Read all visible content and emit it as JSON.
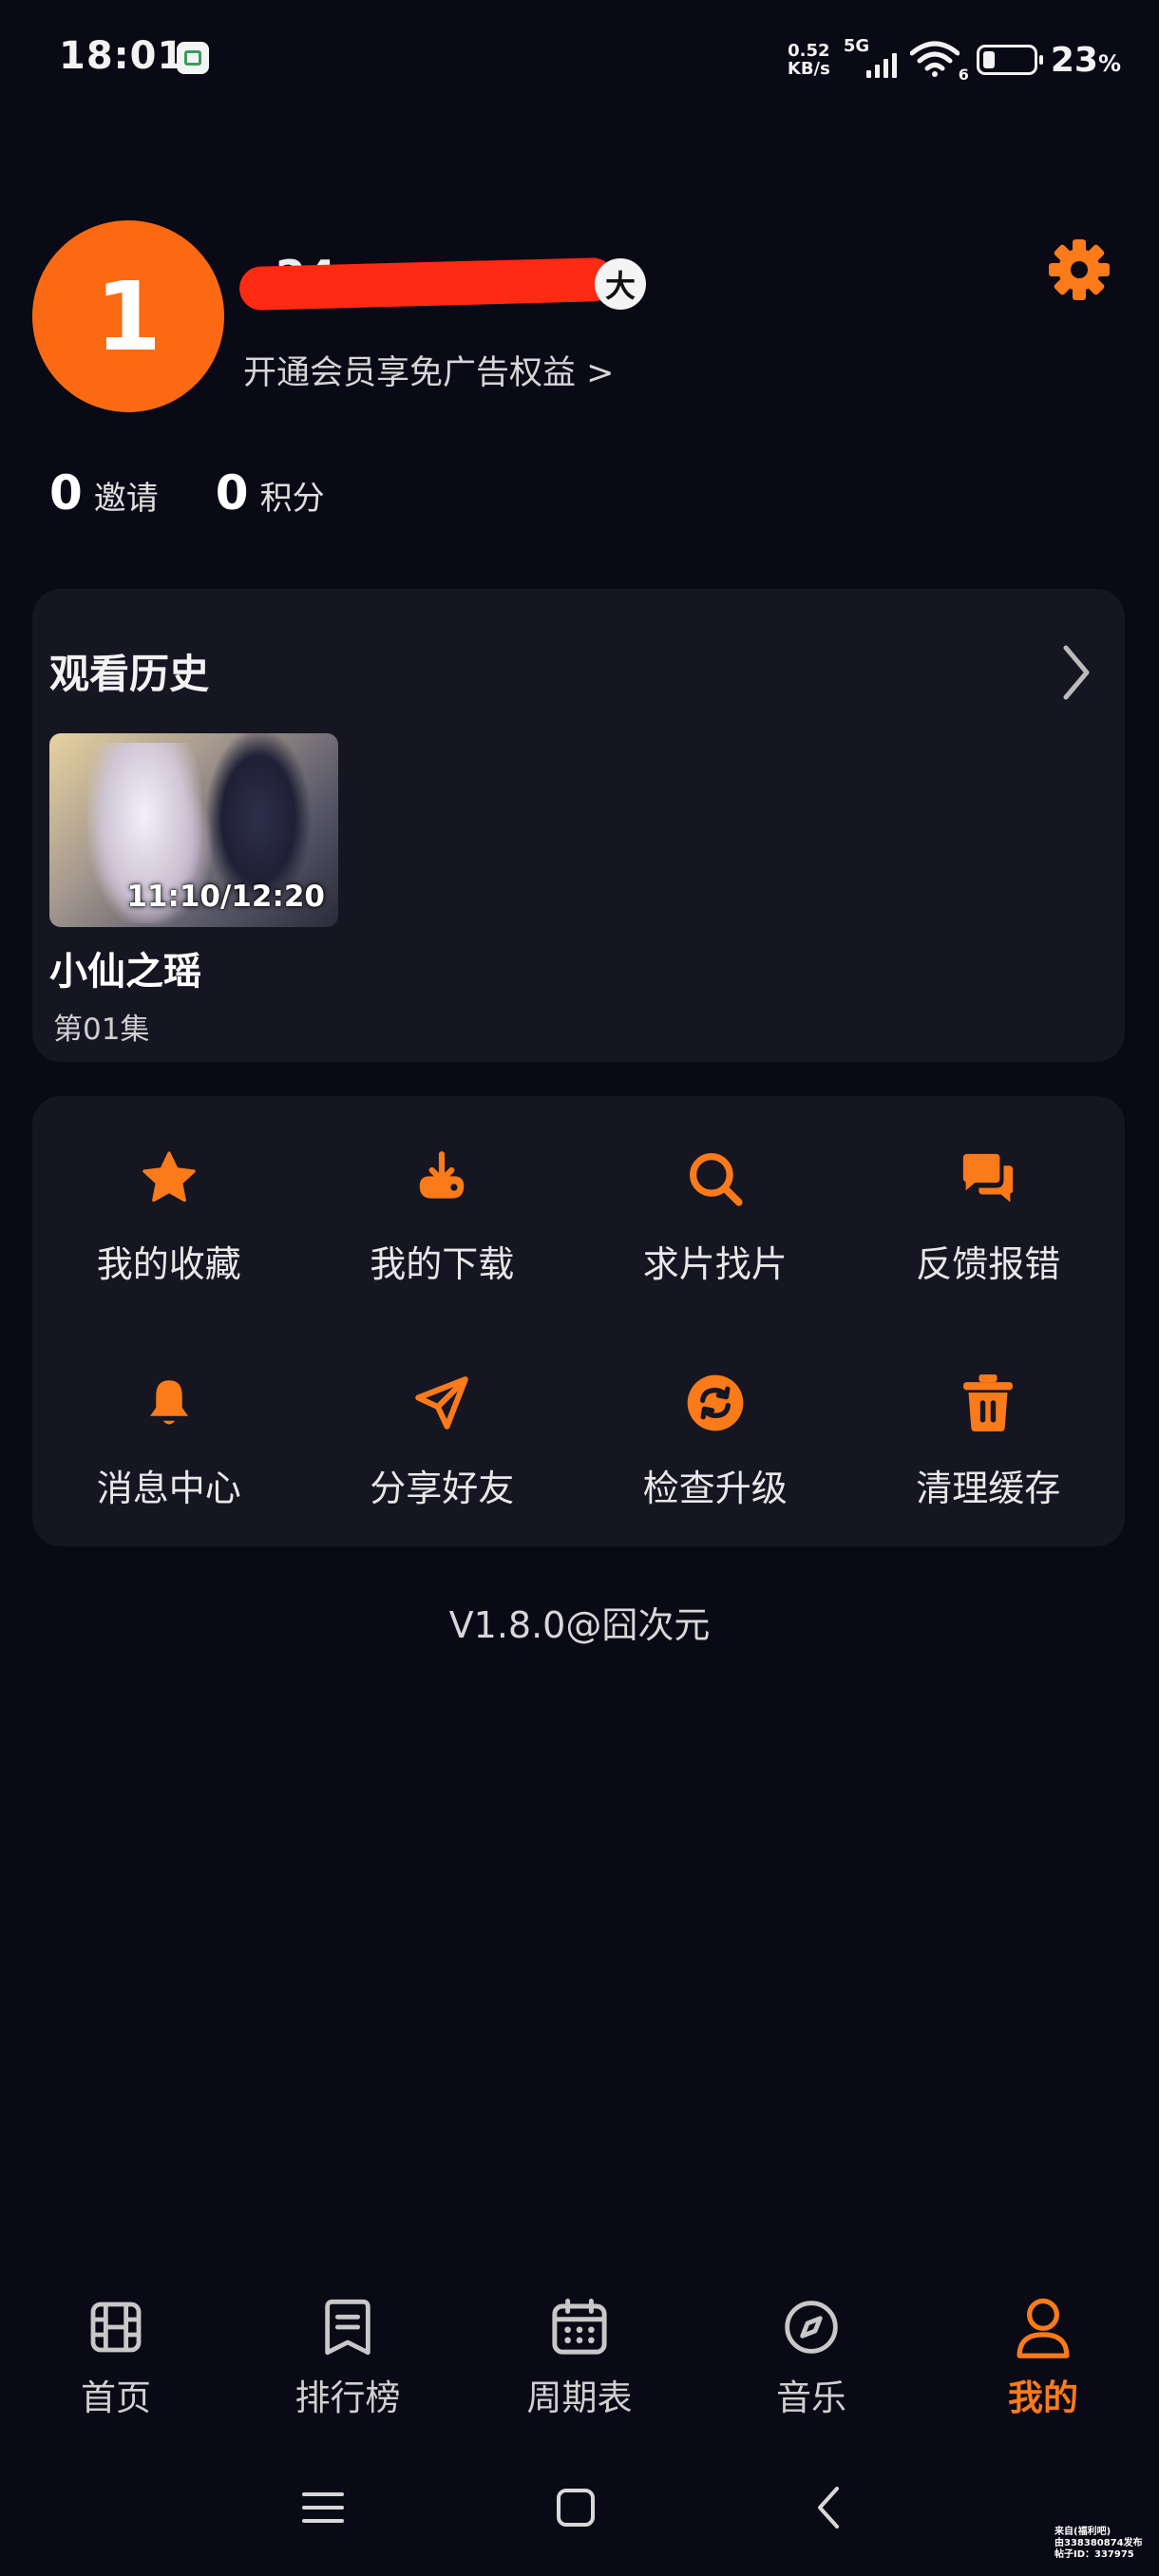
{
  "status_bar": {
    "time": "18:01",
    "net_speed_value": "0.52",
    "net_speed_unit": "KB/s",
    "network_type": "5G",
    "wifi_label": "6",
    "battery_percent": "23",
    "battery_percent_sign": "%",
    "battery_level": 0.23
  },
  "profile": {
    "avatar_text": "1",
    "username_visible": "24",
    "level_badge": "大",
    "vip_prompt": "开通会员享免广告权益 >"
  },
  "stats": [
    {
      "value": "0",
      "label": "邀请"
    },
    {
      "value": "0",
      "label": "积分"
    }
  ],
  "history": {
    "title": "观看历史",
    "items": [
      {
        "title": "小仙之瑶",
        "episode": "第01集",
        "progress_time": "11:10/12:20"
      }
    ]
  },
  "menu": [
    {
      "label": "我的收藏",
      "icon": "star-icon"
    },
    {
      "label": "我的下载",
      "icon": "download-icon"
    },
    {
      "label": "求片找片",
      "icon": "search-icon"
    },
    {
      "label": "反馈报错",
      "icon": "chat-icon"
    },
    {
      "label": "消息中心",
      "icon": "bell-icon"
    },
    {
      "label": "分享好友",
      "icon": "send-icon"
    },
    {
      "label": "检查升级",
      "icon": "refresh-icon"
    },
    {
      "label": "清理缓存",
      "icon": "trash-icon"
    }
  ],
  "version": "V1.8.0@囧次元",
  "tabs": [
    {
      "label": "首页",
      "icon": "film-icon",
      "active": false
    },
    {
      "label": "排行榜",
      "icon": "bookmark-list-icon",
      "active": false
    },
    {
      "label": "周期表",
      "icon": "calendar-icon",
      "active": false
    },
    {
      "label": "音乐",
      "icon": "compass-icon",
      "active": false
    },
    {
      "label": "我的",
      "icon": "user-icon",
      "active": true
    }
  ],
  "watermark": [
    "来自(福利吧)",
    "由338380874发布",
    "帖子ID：337975"
  ],
  "colors": {
    "accent": "#fb7a1a",
    "avatar_bg": "#fb6a12",
    "background": "#0a0a16",
    "card": "#161623"
  }
}
